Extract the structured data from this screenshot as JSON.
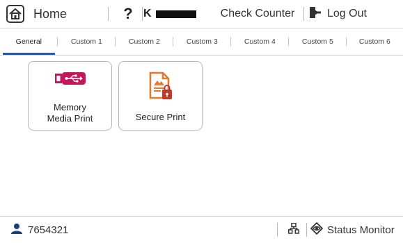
{
  "topbar": {
    "home_label": "Home",
    "help_label": "?",
    "user_initial": "K",
    "check_counter_label": "Check Counter",
    "logout_label": "Log Out"
  },
  "tabs": [
    {
      "label": "General",
      "active": true
    },
    {
      "label": "Custom 1",
      "active": false
    },
    {
      "label": "Custom 2",
      "active": false
    },
    {
      "label": "Custom 3",
      "active": false
    },
    {
      "label": "Custom 4",
      "active": false
    },
    {
      "label": "Custom 5",
      "active": false
    },
    {
      "label": "Custom 6",
      "active": false
    }
  ],
  "tiles": [
    {
      "label_line1": "Memory",
      "label_line2": "Media Print",
      "icon": "usb-memory-icon"
    },
    {
      "label": "Secure Print",
      "icon": "secure-document-icon"
    }
  ],
  "statusbar": {
    "user_id": "7654321",
    "status_monitor_label": "Status Monitor"
  },
  "colors": {
    "accent_blue": "#1f5ab8",
    "icon_magenta": "#c2185b",
    "icon_orange": "#e8772e",
    "lock_red": "#c0392b"
  }
}
